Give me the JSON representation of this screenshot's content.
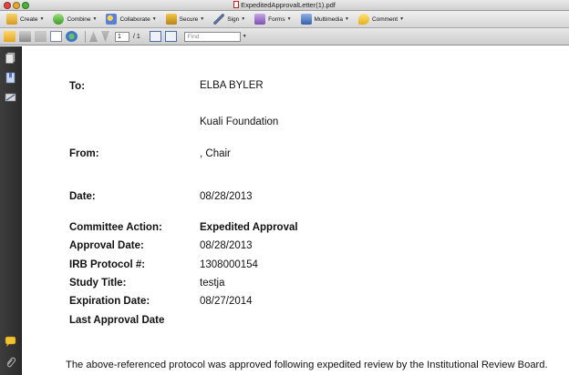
{
  "window": {
    "title": "ExpeditedApprovalLetter(1).pdf"
  },
  "toolbar": {
    "create": "Create",
    "combine": "Combine",
    "collaborate": "Collaborate",
    "secure": "Secure",
    "sign": "Sign",
    "forms": "Forms",
    "multimedia": "Multimedia",
    "comment": "Comment"
  },
  "nav": {
    "page_current": "1",
    "page_total": "/ 1",
    "find_placeholder": "Find"
  },
  "letter": {
    "to_label": "To:",
    "to_name": "ELBA BYLER",
    "to_org": "Kuali Foundation",
    "from_label": "From:",
    "from_value": ", Chair",
    "date_label": "Date:",
    "date_value": "08/28/2013",
    "committee_action_label": "Committee Action:",
    "committee_action_value": "Expedited Approval",
    "approval_date_label": "Approval Date:",
    "approval_date_value": "08/28/2013",
    "protocol_label": "IRB Protocol #:",
    "protocol_value": "1308000154",
    "study_title_label": "Study Title:",
    "study_title_value": "testja",
    "expiration_label": "Expiration Date:",
    "expiration_value": "08/27/2014",
    "last_approval_label": "Last Approval Date",
    "body_text": "The above-referenced protocol was approved following expedited review by the Institutional Review Board."
  },
  "colors": {
    "nav_panel": "#333333",
    "toolbar": "#dcdcdc"
  }
}
